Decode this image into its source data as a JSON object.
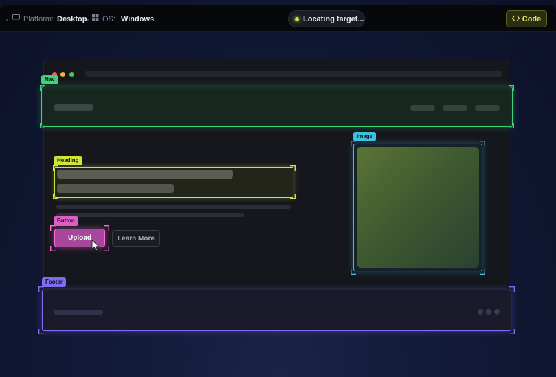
{
  "topbar": {
    "platform_label": "Platform:",
    "platform_value": "Desktop",
    "os_label": "OS:",
    "os_value": "Windows",
    "status_text": "Locating target...",
    "code_label": "Code"
  },
  "icons": {
    "platform": "monitor-icon",
    "os": "windows-icon",
    "code": "code-brackets-icon",
    "cursor": "pointer-cursor-icon"
  },
  "regions": {
    "nav": "Nav",
    "heading": "Heading",
    "button": "Button",
    "image": "Image",
    "footer": "Footer"
  },
  "mock": {
    "upload_label": "Upload",
    "learn_more_label": "Learn More"
  },
  "colors": {
    "nav": "#3fd27a",
    "heading": "#d0e43a",
    "button": "#ff6bd7",
    "image": "#3ac3e0",
    "footer": "#7e6cf0",
    "status_dot": "#c8e63b",
    "code_accent": "#e2ec5a"
  }
}
